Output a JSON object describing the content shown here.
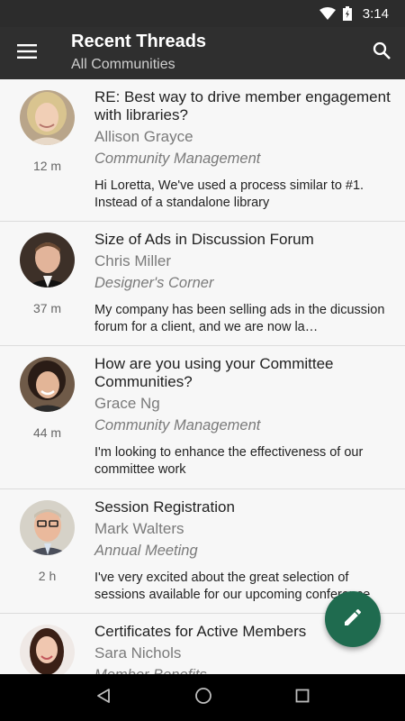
{
  "status_bar": {
    "time": "3:14"
  },
  "app_bar": {
    "title": "Recent Threads",
    "subtitle": "All Communities"
  },
  "threads": [
    {
      "title": "RE: Best way to drive member engagement with libraries?",
      "author": "Allison Grayce",
      "community": "Community Management",
      "snippet": "Hi Loretta, We've used a process similar to #1. Instead of a standalone library",
      "time": "12 m"
    },
    {
      "title": "Size of Ads in Discussion Forum",
      "author": "Chris Miller",
      "community": "Designer's Corner",
      "snippet": "My company has been selling ads in the dicussion forum for a client, and we are now la…",
      "time": "37 m"
    },
    {
      "title": "How are you using your Committee Communities?",
      "author": "Grace Ng",
      "community": "Community Management",
      "snippet": "I'm looking to enhance the effectiveness of our committee work",
      "time": "44 m"
    },
    {
      "title": "Session Registration",
      "author": "Mark Walters",
      "community": "Annual Meeting",
      "snippet": "I've very excited about the great selection of sessions available for our upcoming conference",
      "time": "2 h"
    },
    {
      "title": "Certificates for Active Members",
      "author": "Sara Nichols",
      "community": "Member Benefits",
      "snippet": "",
      "time": ""
    }
  ],
  "fab": {
    "icon": "pencil-icon",
    "color": "#1f6b4f"
  },
  "colors": {
    "app_bar": "#2f2f2f",
    "status_bar": "#2c2c2c",
    "nav_bar": "#000000"
  }
}
